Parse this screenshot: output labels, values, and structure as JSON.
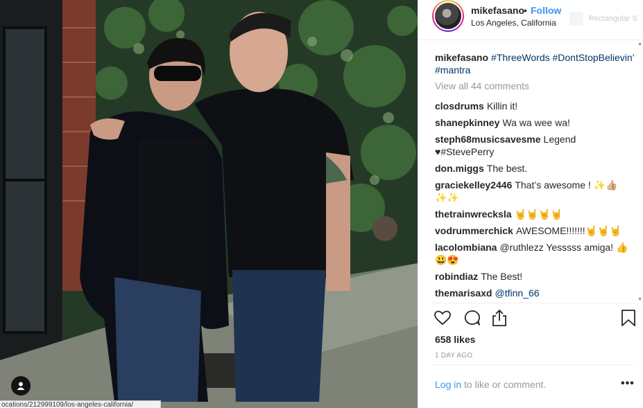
{
  "post": {
    "username": "mikefasano",
    "dot": "•",
    "follow": "Follow",
    "location": "Los Angeles, California",
    "extension_label": "Rectangular S"
  },
  "caption": {
    "user": "mikefasano",
    "text": "#ThreeWords #DontStopBelievin’ #mantra"
  },
  "view_all": "View all 44 comments",
  "comments": [
    {
      "user": "closdrums",
      "text": "Killin it!"
    },
    {
      "user": "shanepkinney",
      "text": "Wa wa wee wa!"
    },
    {
      "user": "steph68musicsavesme",
      "text": "Legend ♥#StevePerry"
    },
    {
      "user": "don.miggs",
      "text": "The best."
    },
    {
      "user": "graciekelley2446",
      "text": "That’s awesome ! ✨👍🏼✨✨"
    },
    {
      "user": "thetrainwrecksla",
      "text": "🤘🤘🤘🤘"
    },
    {
      "user": "vodrummerchick",
      "text": "AWESOME!!!!!!!🤘🤘🤘"
    },
    {
      "user": "lacolombiana",
      "text": "@ruthlezz Yesssss amiga! 👍😃😍"
    },
    {
      "user": "robindiaz",
      "text": "The Best!"
    },
    {
      "user": "themarisaxd",
      "text": "@tfinn_66"
    }
  ],
  "likes": "658 likes",
  "time": "1 DAY AGO",
  "login": {
    "link": "Log in",
    "text": " to like or comment."
  },
  "more": "•••",
  "statusbar": "ocations/212999109/los-angeles-california/",
  "icons": {
    "like": "heart-icon",
    "comment": "comment-icon",
    "share": "share-icon",
    "save": "bookmark-icon",
    "tag": "user-tag-icon"
  },
  "colors": {
    "accent": "#3897f0",
    "link": "#003569",
    "muted": "#999999"
  }
}
